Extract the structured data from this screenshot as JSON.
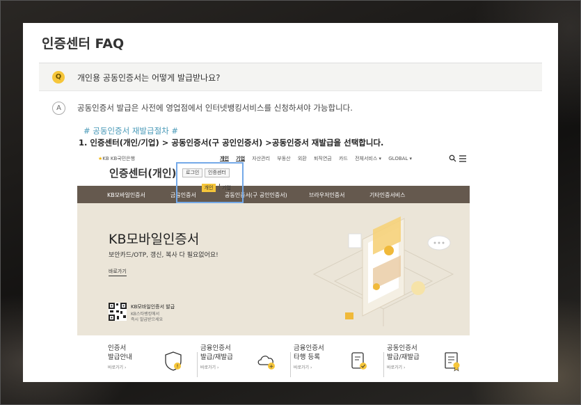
{
  "faq": {
    "title": "인증센터 FAQ",
    "q_badge": "Q",
    "question": "개인용 공동인증서는 어떻게 발급받나요?",
    "a_badge": "A",
    "answer": "공동인증서 발급은 사전에 영업점에서 인터넷뱅킹서비스를 신청하셔야 가능합니다.",
    "hash_title": "# 공동인증서 재발급절차 #",
    "step1": "1. 인증센터(개인/기업) > 공동인증서(구 공인인증서) >공동인증서 재발급을 선택합니다."
  },
  "shot": {
    "bank_name": "KB국민은행",
    "site_title": "인증센터(개인)",
    "login_btn": "로그인",
    "center_btn": "인증센터",
    "popup_personal": "개인",
    "popup_corp": "기업",
    "top_nav": [
      "개인",
      "기업",
      "자산관리",
      "부동산",
      "외환",
      "퇴직연금",
      "카드",
      "전체서비스 ▾",
      "GLOBAL ▾"
    ],
    "menu": [
      "KB모바일인증서",
      "금융인증서",
      "공동인증서(구 공인인증서)",
      "브라우저인증서",
      "기타인증서비스"
    ],
    "hero_title": "KB모바일인증서",
    "hero_sub": "보안카드/OTP, 갱신, 복사 다 필요없어요!",
    "hero_link": "바로가기",
    "qr_title": "KB모바일인증서 발급",
    "qr_sub1": "KB스타뱅킹에서",
    "qr_sub2": "즉시 발급받으세요",
    "cards": [
      {
        "line1": "인증서",
        "line2": "발급안내",
        "link": "바로가기 ›",
        "icon": "shield-icon"
      },
      {
        "line1": "금융인증서",
        "line2": "발급/재발급",
        "link": "바로가기 ›",
        "icon": "cloud-icon"
      },
      {
        "line1": "금융인증서",
        "line2": "타행 등록",
        "link": "바로가기 ›",
        "icon": "document-check-icon"
      },
      {
        "line1": "공동인증서",
        "line2": "발급/재발급",
        "link": "바로가기 ›",
        "icon": "certificate-icon"
      }
    ]
  },
  "colors": {
    "menu_bar": "#65594e",
    "hero_bg": "#ebe5d8",
    "accent_yellow": "#f6c63a",
    "highlight_blue": "#74a9e8",
    "link_blue": "#4a9ab8"
  }
}
